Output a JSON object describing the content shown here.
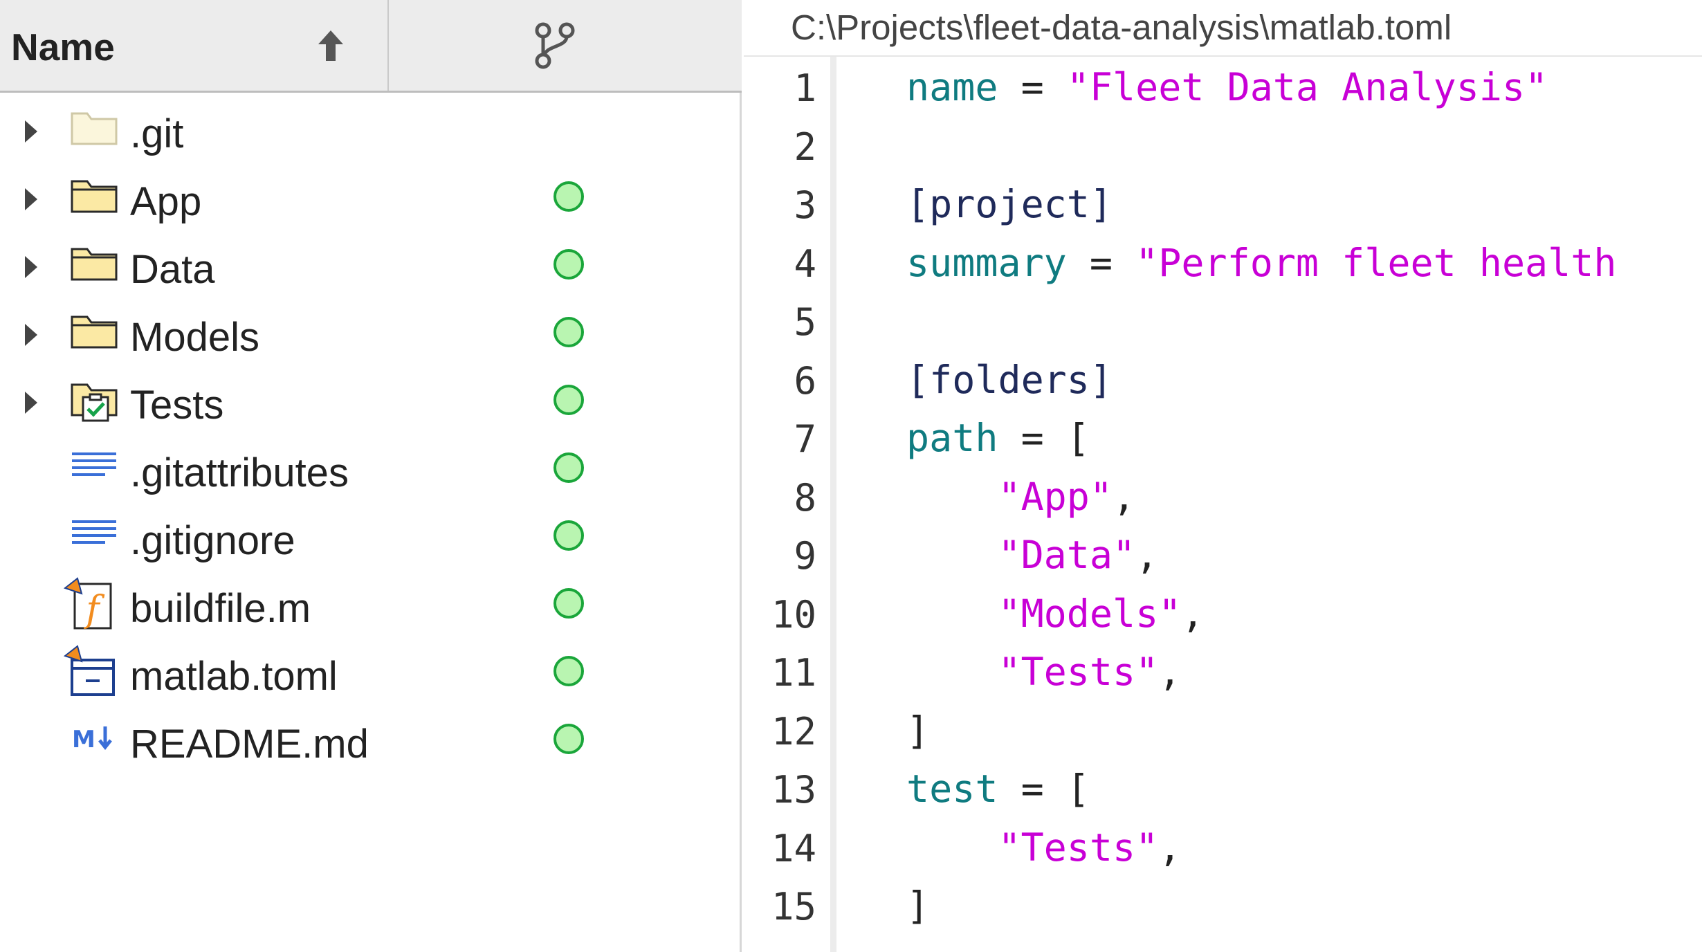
{
  "file_browser": {
    "header": {
      "name_label": "Name",
      "sort_icon": "arrow-up-icon",
      "source_control_icon": "git-branch-icon"
    },
    "items": [
      {
        "name": ".git",
        "icon": "folder-hidden-icon",
        "expandable": true,
        "status": ""
      },
      {
        "name": "App",
        "icon": "folder-icon",
        "expandable": true,
        "status": "unmodified"
      },
      {
        "name": "Data",
        "icon": "folder-icon",
        "expandable": true,
        "status": "unmodified"
      },
      {
        "name": "Models",
        "icon": "folder-icon",
        "expandable": true,
        "status": "unmodified"
      },
      {
        "name": "Tests",
        "icon": "test-folder-icon",
        "expandable": true,
        "status": "unmodified"
      },
      {
        "name": ".gitattributes",
        "icon": "text-file-icon",
        "expandable": false,
        "status": "unmodified"
      },
      {
        "name": ".gitignore",
        "icon": "text-file-icon",
        "expandable": false,
        "status": "unmodified"
      },
      {
        "name": "buildfile.m",
        "icon": "matlab-function-icon",
        "expandable": false,
        "status": "unmodified"
      },
      {
        "name": "matlab.toml",
        "icon": "matlab-project-file-icon",
        "expandable": false,
        "status": "unmodified"
      },
      {
        "name": "README.md",
        "icon": "markdown-icon",
        "expandable": false,
        "status": "unmodified"
      }
    ],
    "status_color": "#1aa63a"
  },
  "editor": {
    "file_path": "C:\\Projects\\fleet-data-analysis\\matlab.toml",
    "lines": [
      {
        "n": "1",
        "parts": [
          {
            "t": "name",
            "c": "k"
          },
          {
            "t": " = ",
            "c": "o"
          },
          {
            "t": "\"Fleet Data Analysis\"",
            "c": "s"
          }
        ]
      },
      {
        "n": "2",
        "parts": []
      },
      {
        "n": "3",
        "parts": [
          {
            "t": "[project]",
            "c": "p"
          }
        ]
      },
      {
        "n": "4",
        "parts": [
          {
            "t": "summary",
            "c": "k"
          },
          {
            "t": " = ",
            "c": "o"
          },
          {
            "t": "\"Perform fleet health",
            "c": "s"
          }
        ]
      },
      {
        "n": "5",
        "parts": []
      },
      {
        "n": "6",
        "parts": [
          {
            "t": "[folders]",
            "c": "p"
          }
        ]
      },
      {
        "n": "7",
        "parts": [
          {
            "t": "path",
            "c": "k"
          },
          {
            "t": " = [",
            "c": "o"
          }
        ]
      },
      {
        "n": "8",
        "parts": [
          {
            "t": "    ",
            "c": "o"
          },
          {
            "t": "\"App\"",
            "c": "s"
          },
          {
            "t": ",",
            "c": "o"
          }
        ]
      },
      {
        "n": "9",
        "parts": [
          {
            "t": "    ",
            "c": "o"
          },
          {
            "t": "\"Data\"",
            "c": "s"
          },
          {
            "t": ",",
            "c": "o"
          }
        ]
      },
      {
        "n": "10",
        "parts": [
          {
            "t": "    ",
            "c": "o"
          },
          {
            "t": "\"Models\"",
            "c": "s"
          },
          {
            "t": ",",
            "c": "o"
          }
        ]
      },
      {
        "n": "11",
        "parts": [
          {
            "t": "    ",
            "c": "o"
          },
          {
            "t": "\"Tests\"",
            "c": "s"
          },
          {
            "t": ",",
            "c": "o"
          }
        ]
      },
      {
        "n": "12",
        "parts": [
          {
            "t": "]",
            "c": "o"
          }
        ]
      },
      {
        "n": "13",
        "parts": [
          {
            "t": "test",
            "c": "k"
          },
          {
            "t": " = [",
            "c": "o"
          }
        ]
      },
      {
        "n": "14",
        "parts": [
          {
            "t": "    ",
            "c": "o"
          },
          {
            "t": "\"Tests\"",
            "c": "s"
          },
          {
            "t": ",",
            "c": "o"
          }
        ]
      },
      {
        "n": "15",
        "parts": [
          {
            "t": "]",
            "c": "o"
          }
        ]
      }
    ],
    "colors": {
      "key": "#0f7b80",
      "string": "#c800d6",
      "section": "#1f2a5a"
    }
  }
}
